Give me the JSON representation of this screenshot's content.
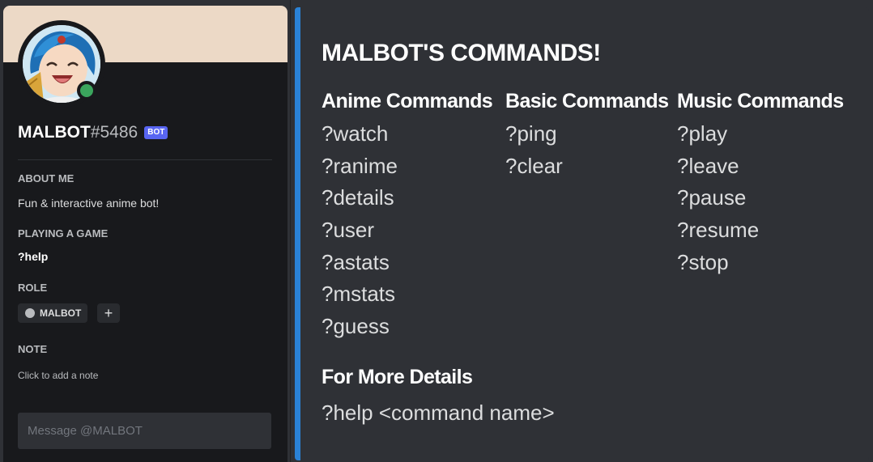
{
  "profile": {
    "username": "MALBOT",
    "discriminator": "#5486",
    "bot_tag": "BOT",
    "about_title": "ABOUT ME",
    "about_text": "Fun & interactive anime bot!",
    "playing_title": "PLAYING A GAME",
    "playing_text": "?help",
    "role_title": "ROLE",
    "role_name": "MALBOT",
    "role_add": "+",
    "note_title": "NOTE",
    "note_placeholder": "Click to add a note",
    "message_placeholder": "Message @MALBOT",
    "colors": {
      "banner": "#ecd9c6",
      "status": "#3ba55d",
      "bot_tag": "#5865f2"
    }
  },
  "embed": {
    "accent_color": "#2a82d6",
    "title": "MALBOT'S COMMANDS!",
    "columns": [
      {
        "heading": "Anime Commands",
        "commands": [
          "?watch",
          "?ranime",
          "?details",
          "?user",
          "?astats",
          "?mstats",
          "?guess"
        ]
      },
      {
        "heading": "Basic Commands",
        "commands": [
          "?ping",
          "?clear"
        ]
      },
      {
        "heading": "Music Commands",
        "commands": [
          "?play",
          "?leave",
          "?pause",
          "?resume",
          "?stop"
        ]
      }
    ],
    "more_heading": "For More Details",
    "more_text": "?help <command name>"
  }
}
